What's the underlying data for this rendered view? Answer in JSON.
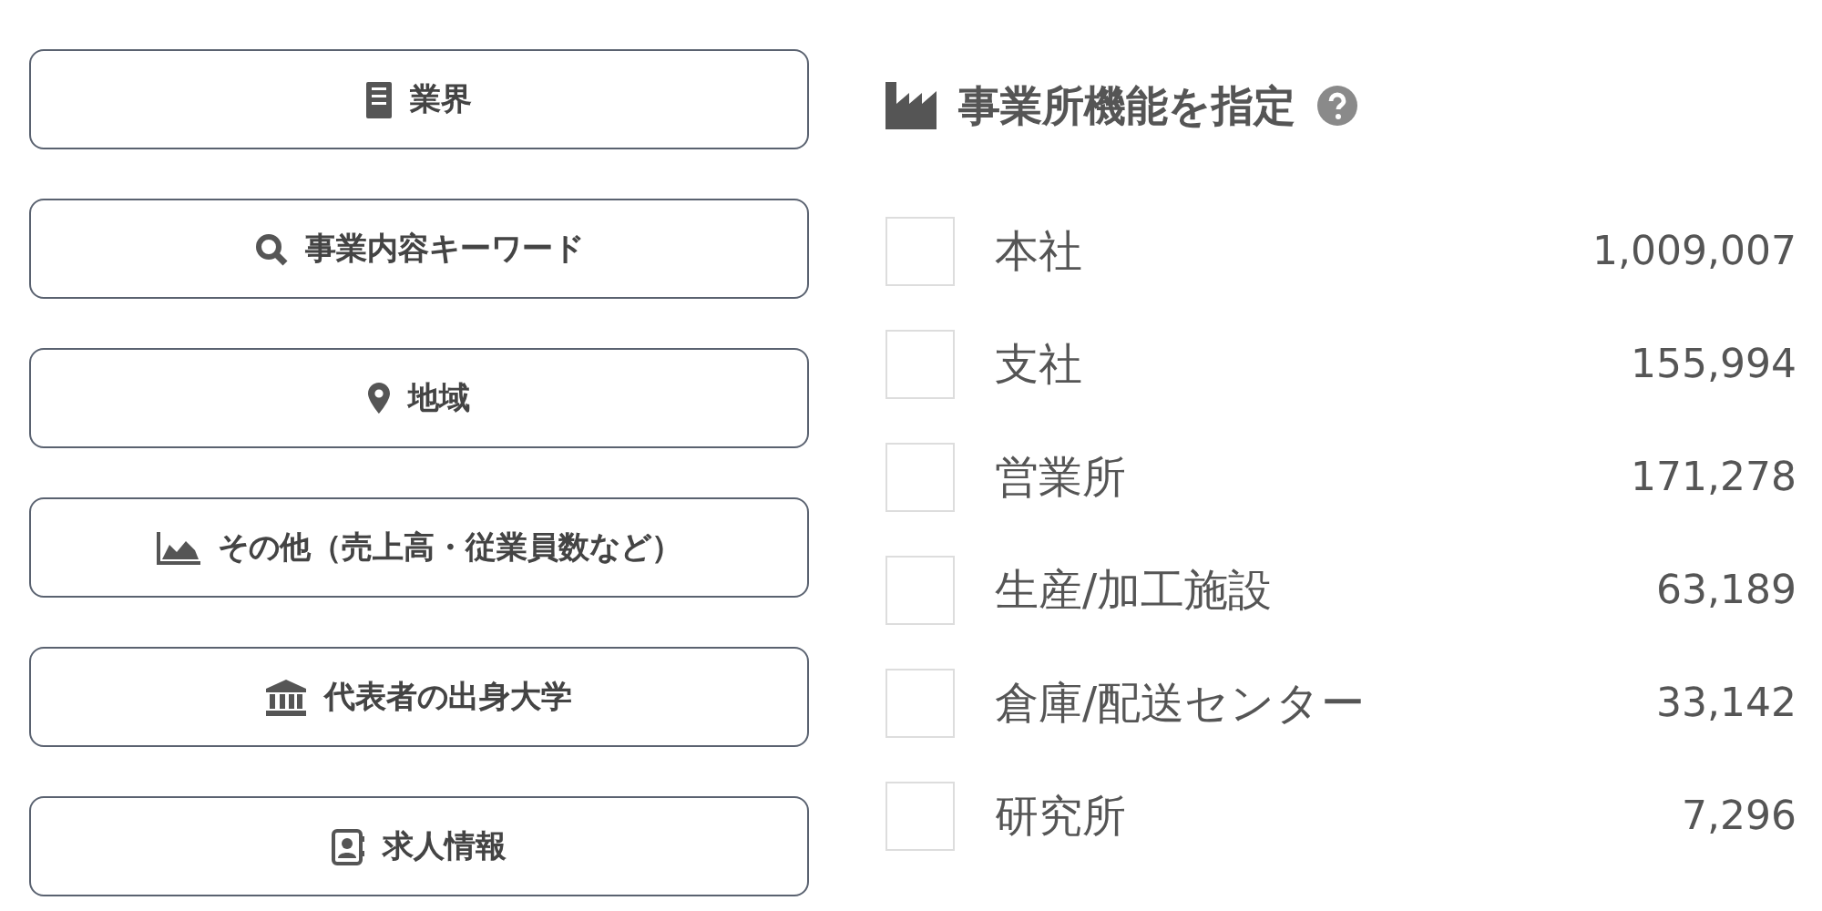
{
  "filter_buttons": [
    {
      "label": "業界"
    },
    {
      "label": "事業内容キーワード"
    },
    {
      "label": "地域"
    },
    {
      "label": "その他（売上高・従業員数など）"
    },
    {
      "label": "代表者の出身大学"
    },
    {
      "label": "求人情報"
    }
  ],
  "office_function": {
    "title": "事業所機能を指定",
    "options": [
      {
        "label": "本社",
        "count": "1,009,007",
        "checked": false
      },
      {
        "label": "支社",
        "count": "155,994",
        "checked": false
      },
      {
        "label": "営業所",
        "count": "171,278",
        "checked": false
      },
      {
        "label": "生産/加工施設",
        "count": "63,189",
        "checked": false
      },
      {
        "label": "倉庫/配送センター",
        "count": "33,142",
        "checked": false
      },
      {
        "label": "研究所",
        "count": "7,296",
        "checked": false
      }
    ]
  }
}
